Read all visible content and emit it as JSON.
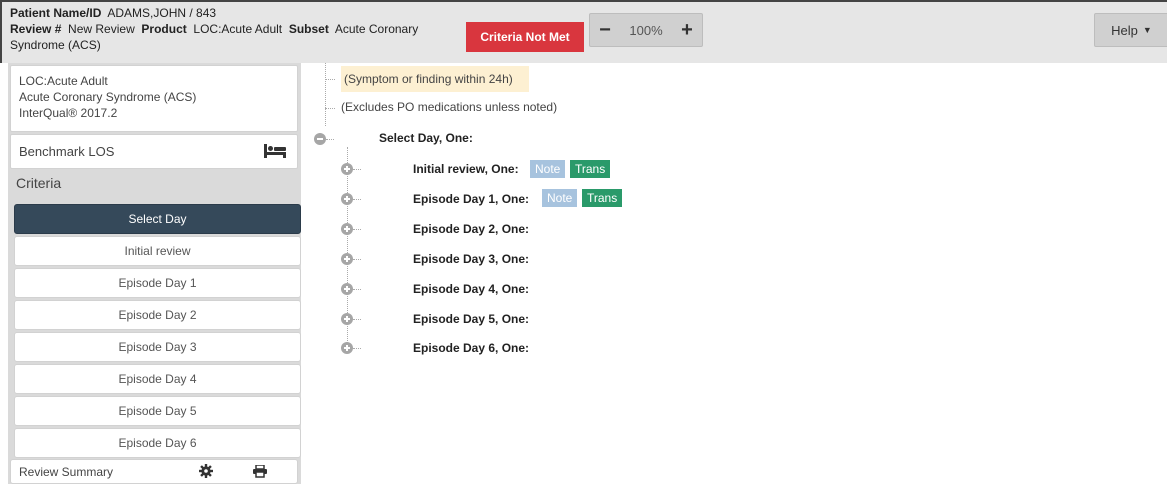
{
  "header": {
    "patient_label": "Patient Name/ID",
    "patient_value": "ADAMS,JOHN / 843",
    "review_label": "Review #",
    "review_value": "New Review",
    "product_label": "Product",
    "product_value": "LOC:Acute Adult",
    "subset_label": "Subset",
    "subset_value": "Acute Coronary Syndrome (ACS)",
    "status_badge": "Criteria Not Met",
    "zoom_minus": "−",
    "zoom_value": "100%",
    "zoom_plus": "+",
    "help_label": "Help"
  },
  "sidebar": {
    "info_line1": "LOC:Acute Adult",
    "info_line2": "Acute Coronary Syndrome (ACS)",
    "info_line3": "InterQual® 2017.2",
    "benchmark_label": "Benchmark LOS",
    "criteria_heading": "Criteria",
    "items": [
      {
        "label": "Select Day",
        "active": true
      },
      {
        "label": "Initial review"
      },
      {
        "label": "Episode Day 1"
      },
      {
        "label": "Episode Day 2"
      },
      {
        "label": "Episode Day 3"
      },
      {
        "label": "Episode Day 4"
      },
      {
        "label": "Episode Day 5"
      },
      {
        "label": "Episode Day 6"
      }
    ],
    "summary_label": "Review Summary"
  },
  "tree": {
    "note_highlight": "(Symptom or finding within 24h)",
    "note_plain": "(Excludes PO medications unless noted)",
    "select_day_label": "Select Day, One:",
    "rows": [
      {
        "label": "Initial review, One:",
        "note": "Note",
        "trans": "Trans"
      },
      {
        "label": "Episode Day 1, One:",
        "note": "Note",
        "trans": "Trans"
      },
      {
        "label": "Episode Day 2, One:"
      },
      {
        "label": "Episode Day 3, One:"
      },
      {
        "label": "Episode Day 4, One:"
      },
      {
        "label": "Episode Day 5, One:"
      },
      {
        "label": "Episode Day 6, One:"
      }
    ]
  },
  "colors": {
    "status_badge": "#d9363e",
    "active_nav": "#35495a",
    "note_tag": "#a7c3de",
    "trans_tag": "#2a9a6a",
    "highlight": "#fdf0d2"
  },
  "icons": {
    "benchmark": "bed-icon",
    "settings": "gear-icon",
    "print": "printer-icon",
    "expand": "plus-circle-icon",
    "collapse": "minus-circle-icon",
    "dropdown": "caret-down-icon"
  }
}
